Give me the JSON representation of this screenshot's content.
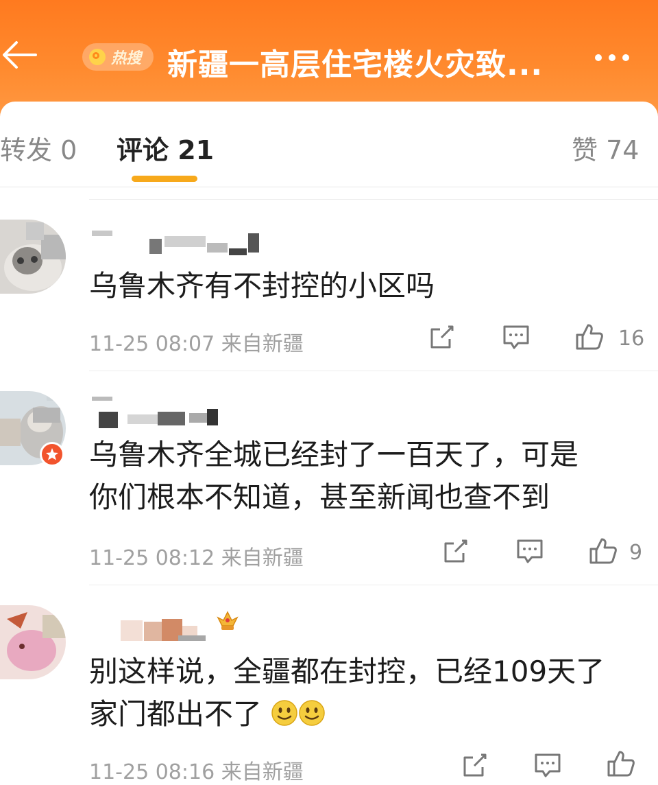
{
  "header": {
    "hot_label": "热搜",
    "title": "新疆一高层住宅楼火灾致..."
  },
  "tabs": [
    {
      "label": "转发 0"
    },
    {
      "label": "评论 21"
    },
    {
      "label": "赞 74"
    }
  ],
  "comments": [
    {
      "text_lines": [
        "乌鲁木齐有不封控的小区吗"
      ],
      "time": "11-25 08:07",
      "source": "来自新疆",
      "likes": "16"
    },
    {
      "text_lines": [
        "乌鲁木齐全城已经封了一百天了，可是",
        "你们根本不知道，甚至新闻也查不到"
      ],
      "time": "11-25 08:12",
      "source": "来自新疆",
      "likes": "9"
    },
    {
      "text_lines": [
        "别这样说，全疆都在封控，已经109天了",
        "家门都出不了"
      ],
      "time": "11-25 08:16",
      "source": "来自新疆",
      "likes": ""
    }
  ],
  "colors": {
    "header_orange": "#ff7a1f",
    "tab_underline": "#f7a91b"
  }
}
